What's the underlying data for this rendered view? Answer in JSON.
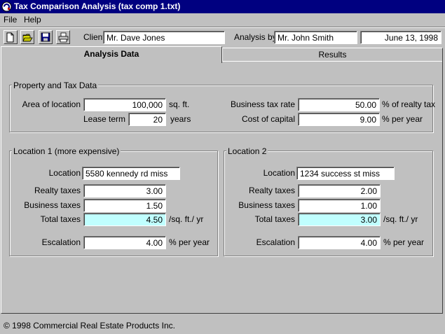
{
  "window": {
    "title": "Tax Comparison Analysis  (tax comp 1.txt)"
  },
  "menu": {
    "file": "File",
    "help": "Help"
  },
  "toolbar": {
    "icons": [
      "new-file-icon",
      "open-folder-icon",
      "save-disk-icon",
      "print-icon"
    ],
    "client_label": "Client",
    "client_value": "Mr. Dave Jones",
    "analysis_by_label": "Analysis by",
    "analysis_by_value": "Mr. John Smith",
    "date_value": "June 13, 1998"
  },
  "tabs": {
    "analysis_data": "Analysis Data",
    "results": "Results",
    "active": "analysis_data"
  },
  "property": {
    "title": "Property and Tax Data",
    "area_label": "Area of location",
    "area_value": "100,000",
    "area_unit": "sq. ft.",
    "lease_label": "Lease term",
    "lease_value": "20",
    "lease_unit": "years",
    "business_rate_label": "Business tax rate",
    "business_rate_value": "50.00",
    "business_rate_unit": "% of realty tax",
    "capital_label": "Cost of capital",
    "capital_value": "9.00",
    "capital_unit": "% per year"
  },
  "location1": {
    "title": "Location 1 (more expensive)",
    "location_label": "Location",
    "location_value": "5580 kennedy rd miss",
    "realty_label": "Realty taxes",
    "realty_value": "3.00",
    "business_label": "Business taxes",
    "business_value": "1.50",
    "total_label": "Total taxes",
    "total_value": "4.50",
    "total_unit": "/sq. ft./ yr",
    "escalation_label": "Escalation",
    "escalation_value": "4.00",
    "escalation_unit": "% per year"
  },
  "location2": {
    "title": "Location 2",
    "location_label": "Location",
    "location_value": "1234 success st miss",
    "realty_label": "Realty taxes",
    "realty_value": "2.00",
    "business_label": "Business taxes",
    "business_value": "1.00",
    "total_label": "Total taxes",
    "total_value": "3.00",
    "total_unit": "/sq. ft./ yr",
    "escalation_label": "Escalation",
    "escalation_value": "4.00",
    "escalation_unit": "% per year"
  },
  "status": {
    "copyright": "© 1998 Commercial Real Estate Products Inc."
  },
  "colors": {
    "titlebar": "#000080",
    "window_bg": "#c0c0c0",
    "computed_field": "#c0ffff"
  }
}
